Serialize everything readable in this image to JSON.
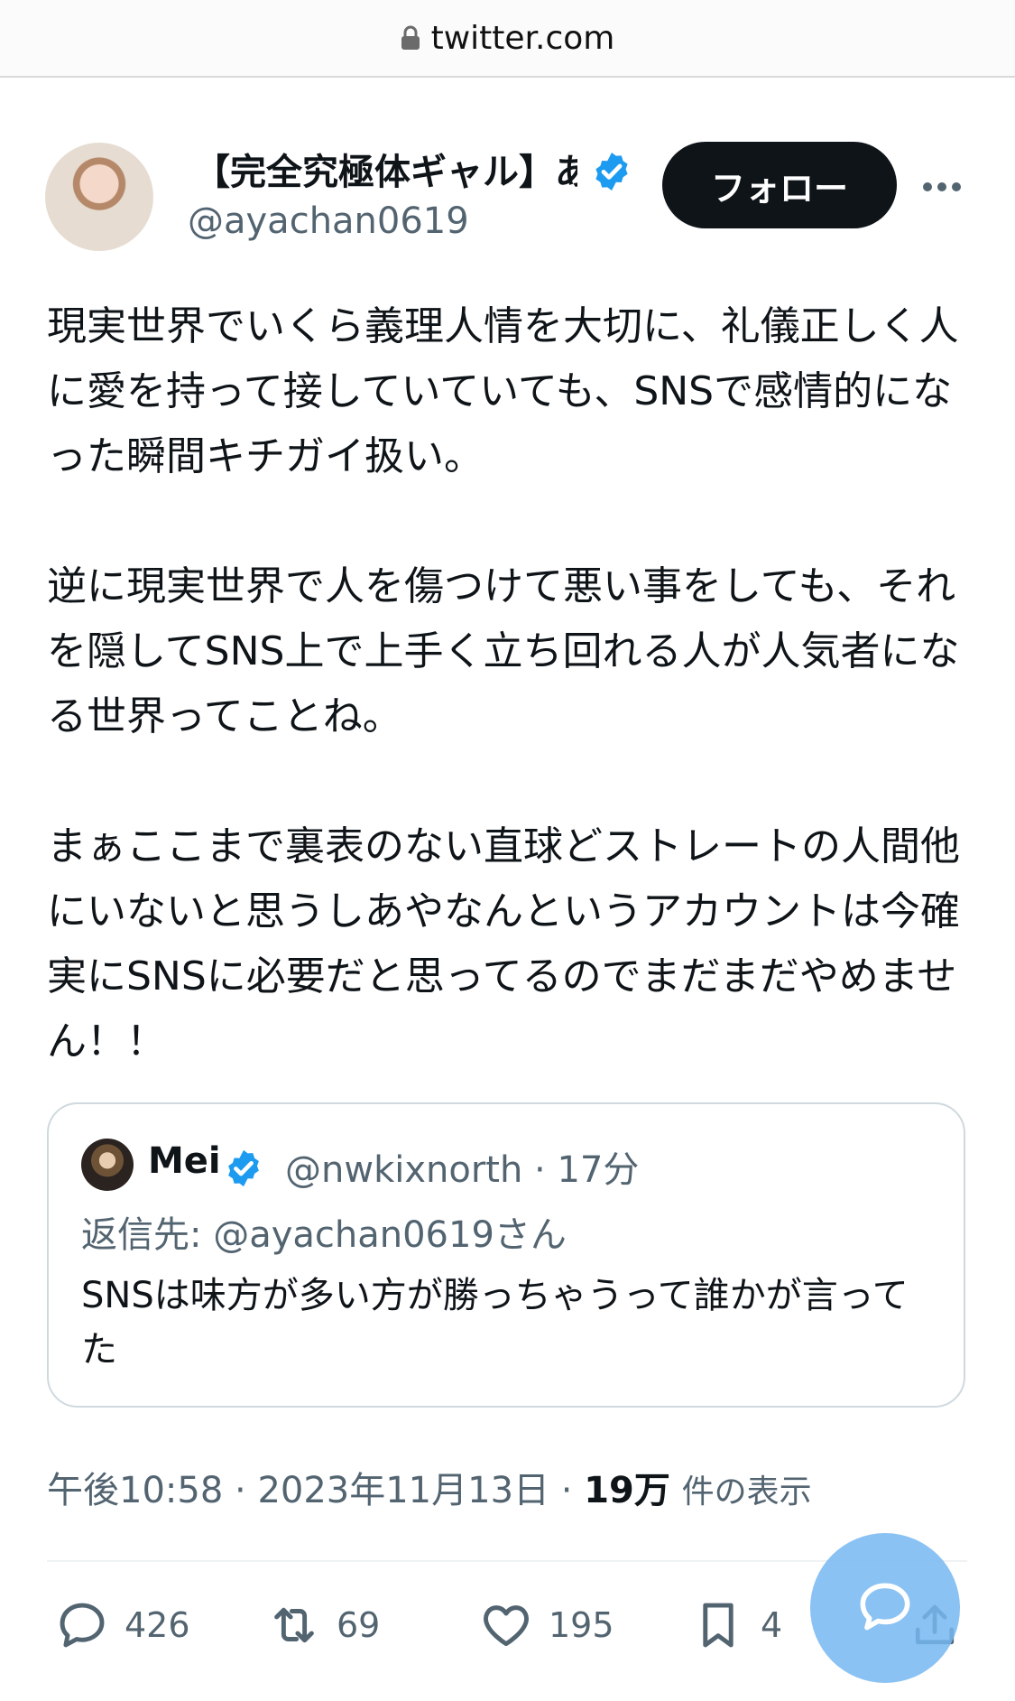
{
  "browser": {
    "url": "twitter.com",
    "lock_icon": "lock-icon"
  },
  "tweet": {
    "author_name": "【完全究極体ギャル】あ",
    "handle": "@ayachan0619",
    "follow_label": "フォロー",
    "text": "現実世界でいくら義理人情を大切に、礼儀正しく人に愛を持って接していていても、SNSで感情的になった瞬間キチガイ扱い。\n\n逆に現実世界で人を傷つけて悪い事をしても、それを隠してSNS上で上手く立ち回れる人が人気者になる世界ってことね。\n\nまぁここまで裏表のない直球どストレートの人間他にいないと思うしあやなんというアカウントは今確実にSNSに必要だと思ってるのでまだまだやめません！！",
    "time": "午後10:58",
    "date": "2023年11月13日",
    "view_count": "19万",
    "view_label": "件の表示",
    "sep": "·"
  },
  "quote": {
    "name": "Mei",
    "handle_time": "@nwkixnorth · 17分",
    "reply_to": "返信先: @ayachan0619さん",
    "text": "SNSは味方が多い方が勝っちゃうって誰かが言ってた"
  },
  "actions": {
    "replies": "426",
    "retweets": "69",
    "likes": "195",
    "bookmarks": "4"
  },
  "colors": {
    "text": "#0f1419",
    "secondary": "#536471",
    "verified": "#1d9bf0",
    "follow_bg": "#0f1419",
    "fab": "#76b7f1",
    "border": "#cfd9de"
  }
}
